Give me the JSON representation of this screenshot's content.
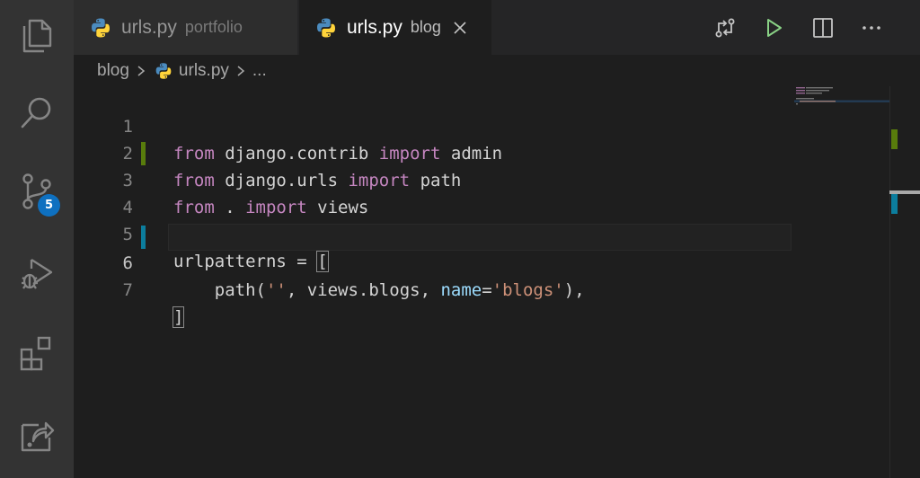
{
  "activity_bar": {
    "items": [
      {
        "name": "explorer-icon"
      },
      {
        "name": "search-icon"
      },
      {
        "name": "source-control-icon",
        "badge": "5"
      },
      {
        "name": "run-debug-icon"
      },
      {
        "name": "extensions-icon"
      },
      {
        "name": "remote-explorer-icon"
      }
    ]
  },
  "tabs": [
    {
      "file": "urls.py",
      "description": "portfolio",
      "active": false
    },
    {
      "file": "urls.py",
      "description": "blog",
      "active": true
    }
  ],
  "editor_actions": [
    "compare-changes-icon",
    "run-python-file-icon",
    "split-editor-icon",
    "more-actions-icon"
  ],
  "breadcrumb": {
    "folder": "blog",
    "file": "urls.py",
    "more": "..."
  },
  "code_lines": [
    {
      "number": "1"
    },
    {
      "number": "2"
    },
    {
      "number": "3"
    },
    {
      "number": "4"
    },
    {
      "number": "5"
    },
    {
      "number": "6"
    },
    {
      "number": "7"
    }
  ],
  "tokens": {
    "from": "from",
    "import": "import",
    "l1_mod": " django.contrib ",
    "l1_name": " admin",
    "l2_mod": " django.urls ",
    "l2_name": " path",
    "l3_mod": " . ",
    "l3_name": " views",
    "l5_var": "urlpatterns ",
    "l5_eq": "=",
    "l5_sp": " ",
    "l5_open": "[",
    "l6_indent": "    ",
    "l6_call": "path(",
    "l6_empty": "''",
    "l6_mid": ", views.blogs, ",
    "l6_kw": "name",
    "l6_eq": "=",
    "l6_str": "'blogs'",
    "l6_end": "),",
    "l7_close": "]"
  },
  "colors": {
    "activity_bar": "#333333",
    "editor_bg": "#1e1e1e",
    "keyword": "#c586c0",
    "import_kw": "#d7ba7d",
    "string": "#ce9178",
    "param": "#9cdcfe",
    "badge": "#0e70c0",
    "git_added": "#587c0c",
    "git_modified": "#0c7d9d",
    "run_button": "#89d185"
  }
}
